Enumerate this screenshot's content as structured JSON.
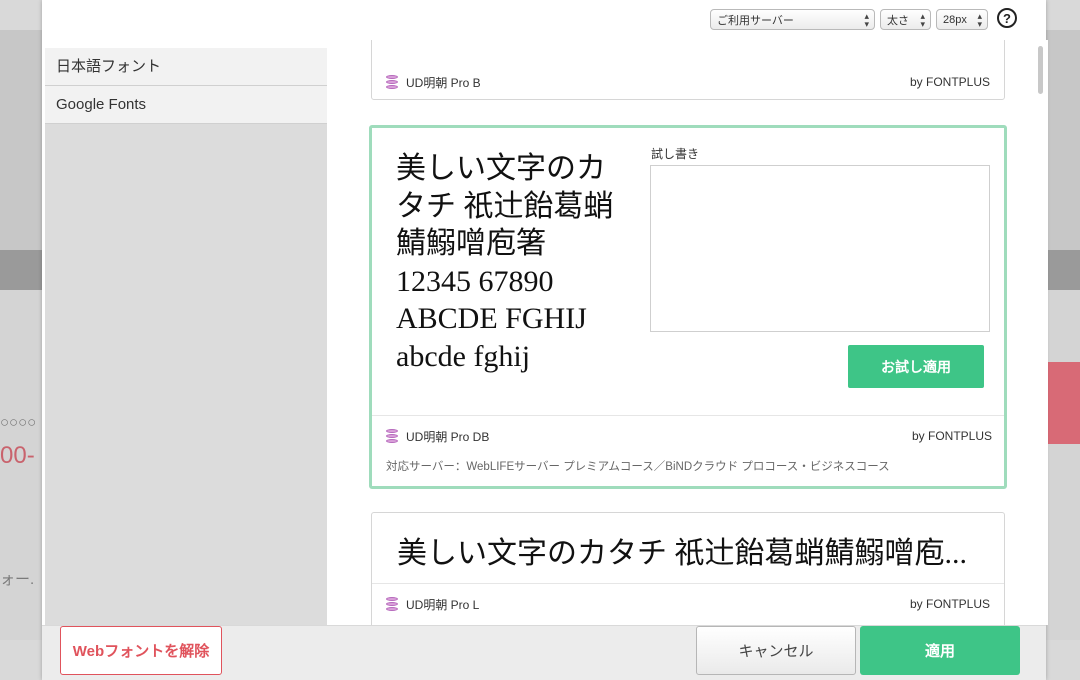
{
  "toolbar": {
    "server_select": "ご利用サーバー",
    "weight_select": "太さ",
    "size_select": "28px",
    "help_label": "?"
  },
  "sidebar": {
    "items": [
      {
        "label": "日本語フォント"
      },
      {
        "label": "Google Fonts"
      }
    ]
  },
  "fonts": [
    {
      "name": "UD明朝 Pro B",
      "by": "by FONTPLUS"
    },
    {
      "name": "UD明朝 Pro DB",
      "by": "by FONTPLUS",
      "sample_lines": [
        "美しい文字のカ",
        "タチ 祇辻飴葛蛸",
        "鯖鰯噌庖箸",
        "12345 67890",
        "ABCDE FGHIJ",
        "abcde fghij"
      ],
      "trial_label": "試し書き",
      "trial_text": "",
      "trial_button": "お試し適用",
      "servers": "対応サーバー：WebLIFEサーバー プレミアムコース／BiNDクラウド プロコース・ビジネスコース"
    },
    {
      "name": "UD明朝 Pro L",
      "by": "by FONTPLUS",
      "sample_line": "美しい文字のカタチ 祇辻飴葛蛸鯖鰯噌庖..."
    }
  ],
  "footer": {
    "unset_label": "Webフォントを解除",
    "cancel_label": "キャンセル",
    "apply_label": "適用"
  },
  "background_fragments": {
    "circles": "○○○○",
    "price": "00-",
    "text": "ォー."
  },
  "colors": {
    "accent_green": "#3ec587",
    "danger_red": "#e0535c",
    "selected_border": "#9fdcbc",
    "db_icon": "#c77ac9"
  },
  "icons": {
    "select_caret": "select-caret-icon",
    "help": "help-icon",
    "font_db": "database-icon"
  }
}
